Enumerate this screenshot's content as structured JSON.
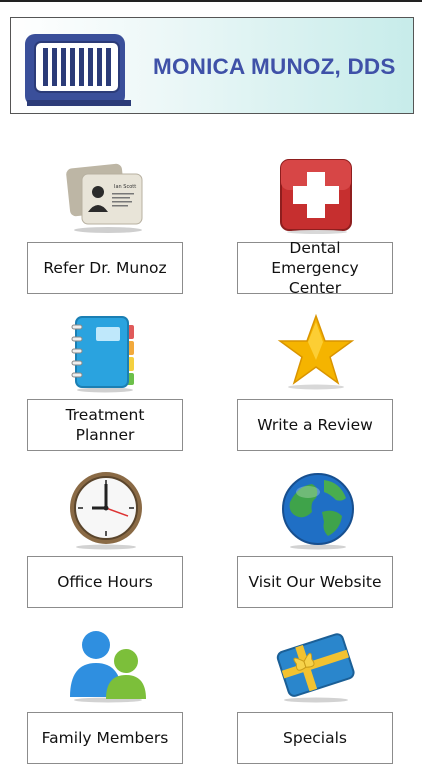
{
  "header": {
    "practice_name": "MONICA MUNOZ, DDS"
  },
  "tiles": [
    {
      "label": "Refer Dr. Munoz",
      "icon": "contact-cards-icon",
      "card_name": "Ian Scott"
    },
    {
      "label": "Dental Emergency Center",
      "icon": "first-aid-cross-icon"
    },
    {
      "label": "Treatment Planner",
      "icon": "planner-notebook-icon"
    },
    {
      "label": "Write a Review",
      "icon": "star-icon"
    },
    {
      "label": "Office Hours",
      "icon": "clock-icon"
    },
    {
      "label": "Visit Our Website",
      "icon": "globe-icon"
    },
    {
      "label": "Family Members",
      "icon": "family-members-icon"
    },
    {
      "label": "Specials",
      "icon": "gift-card-icon"
    }
  ],
  "colors": {
    "title": "#3f51a8",
    "emergency_red": "#c62f2f",
    "star": "#f5b400",
    "planner_blue": "#2aa3df"
  }
}
